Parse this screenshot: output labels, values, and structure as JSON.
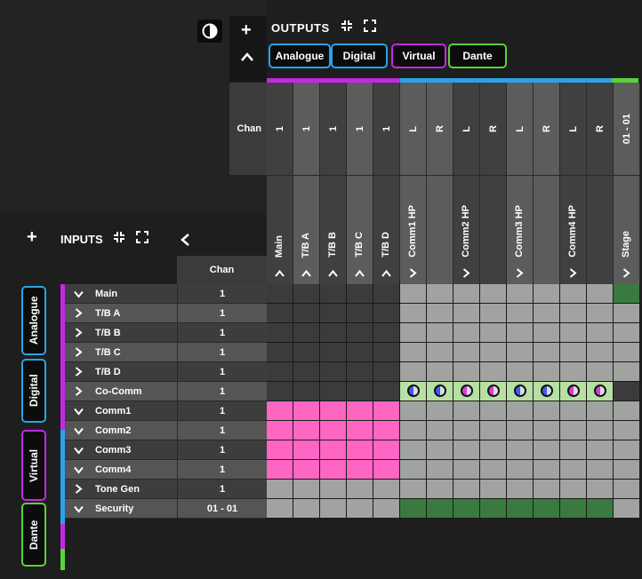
{
  "outputs": {
    "add_label": "+",
    "title": "OUTPUTS",
    "tabs": [
      {
        "label": "Analogue",
        "color": "#2aa3e6"
      },
      {
        "label": "Digital",
        "color": "#2aa3e6"
      },
      {
        "label": "Virtual",
        "color": "#c428e6"
      },
      {
        "label": "Dante",
        "color": "#5bd13a"
      }
    ],
    "chan_label": "Chan",
    "columns": [
      {
        "chan": "1",
        "name": "Main",
        "chevron": "^",
        "shade": "dark"
      },
      {
        "chan": "1",
        "name": "T/B A",
        "chevron": "^",
        "shade": "light"
      },
      {
        "chan": "1",
        "name": "T/B B",
        "chevron": "^",
        "shade": "dark"
      },
      {
        "chan": "1",
        "name": "T/B C",
        "chevron": "^",
        "shade": "light"
      },
      {
        "chan": "1",
        "name": "T/B D",
        "chevron": "^",
        "shade": "dark"
      },
      {
        "chan": "L",
        "name": "Comm1 HP",
        "chevron": ">",
        "shade": "light"
      },
      {
        "chan": "R",
        "name": "",
        "chevron": "",
        "shade": "light"
      },
      {
        "chan": "L",
        "name": "Comm2 HP",
        "chevron": ">",
        "shade": "dark"
      },
      {
        "chan": "R",
        "name": "",
        "chevron": "",
        "shade": "dark"
      },
      {
        "chan": "L",
        "name": "Comm3 HP",
        "chevron": ">",
        "shade": "light"
      },
      {
        "chan": "R",
        "name": "",
        "chevron": "",
        "shade": "light"
      },
      {
        "chan": "L",
        "name": "Comm4 HP",
        "chevron": ">",
        "shade": "dark"
      },
      {
        "chan": "R",
        "name": "",
        "chevron": "",
        "shade": "dark"
      },
      {
        "chan": "01 - 01",
        "name": "Stage",
        "chevron": ">",
        "shade": "light"
      }
    ]
  },
  "inputs": {
    "add_label": "+",
    "title": "INPUTS",
    "chan_label": "Chan",
    "tabs": [
      {
        "label": "Analogue",
        "color": "#2aa3e6"
      },
      {
        "label": "Digital",
        "color": "#2aa3e6"
      },
      {
        "label": "Virtual",
        "color": "#c428e6"
      },
      {
        "label": "Dante",
        "color": "#5bd13a"
      }
    ],
    "rows": [
      {
        "chevron": "v",
        "name": "Main",
        "chan": "1"
      },
      {
        "chevron": ">",
        "name": "T/B A",
        "chan": "1"
      },
      {
        "chevron": ">",
        "name": "T/B B",
        "chan": "1"
      },
      {
        "chevron": ">",
        "name": "T/B C",
        "chan": "1"
      },
      {
        "chevron": ">",
        "name": "T/B D",
        "chan": "1"
      },
      {
        "chevron": ">",
        "name": "Co-Comm",
        "chan": "1"
      },
      {
        "chevron": "v",
        "name": "Comm1",
        "chan": "1"
      },
      {
        "chevron": "v",
        "name": "Comm2",
        "chan": "1"
      },
      {
        "chevron": "v",
        "name": "Comm3",
        "chan": "1"
      },
      {
        "chevron": "v",
        "name": "Comm4",
        "chan": "1"
      },
      {
        "chevron": ">",
        "name": "Tone Gen",
        "chan": "1"
      },
      {
        "chevron": "v",
        "name": "Security",
        "chan": "01 - 01"
      }
    ]
  },
  "colors": {
    "analogue": "#2aa3e6",
    "virtual": "#c428e6",
    "dante": "#5bd13a",
    "routed_pink": "#ff66c4",
    "crosspoint_green": "#3a7a3f",
    "node_green": "#b6e0a4",
    "grid_grey": "#a1a3a1",
    "grid_dark": "#3b3b3b"
  },
  "grid": [
    [
      "d",
      "d",
      "d",
      "d",
      "d",
      "g",
      "g",
      "g",
      "g",
      "g",
      "g",
      "g",
      "g",
      "G"
    ],
    [
      "d",
      "d",
      "d",
      "d",
      "d",
      "g",
      "g",
      "g",
      "g",
      "g",
      "g",
      "g",
      "g",
      "g"
    ],
    [
      "d",
      "d",
      "d",
      "d",
      "d",
      "g",
      "g",
      "g",
      "g",
      "g",
      "g",
      "g",
      "g",
      "g"
    ],
    [
      "d",
      "d",
      "d",
      "d",
      "d",
      "g",
      "g",
      "g",
      "g",
      "g",
      "g",
      "g",
      "g",
      "g"
    ],
    [
      "d",
      "d",
      "d",
      "d",
      "d",
      "g",
      "g",
      "g",
      "g",
      "g",
      "g",
      "g",
      "g",
      "g"
    ],
    [
      "d",
      "d",
      "d",
      "d",
      "d",
      "nb",
      "nb",
      "nm",
      "nm",
      "nb",
      "nb",
      "nm",
      "nm",
      "x"
    ],
    [
      "p",
      "p",
      "p",
      "p",
      "p",
      "g",
      "g",
      "g",
      "g",
      "g",
      "g",
      "g",
      "g",
      "g"
    ],
    [
      "p",
      "p",
      "p",
      "p",
      "p",
      "g",
      "g",
      "g",
      "g",
      "g",
      "g",
      "g",
      "g",
      "g"
    ],
    [
      "p",
      "p",
      "p",
      "p",
      "p",
      "g",
      "g",
      "g",
      "g",
      "g",
      "g",
      "g",
      "g",
      "g"
    ],
    [
      "p",
      "p",
      "p",
      "p",
      "p",
      "g",
      "g",
      "g",
      "g",
      "g",
      "g",
      "g",
      "g",
      "g"
    ],
    [
      "g",
      "g",
      "g",
      "g",
      "g",
      "g",
      "g",
      "g",
      "g",
      "g",
      "g",
      "g",
      "g",
      "g"
    ],
    [
      "g",
      "g",
      "g",
      "g",
      "g",
      "G",
      "G",
      "G",
      "G",
      "G",
      "G",
      "G",
      "G",
      "g"
    ]
  ]
}
